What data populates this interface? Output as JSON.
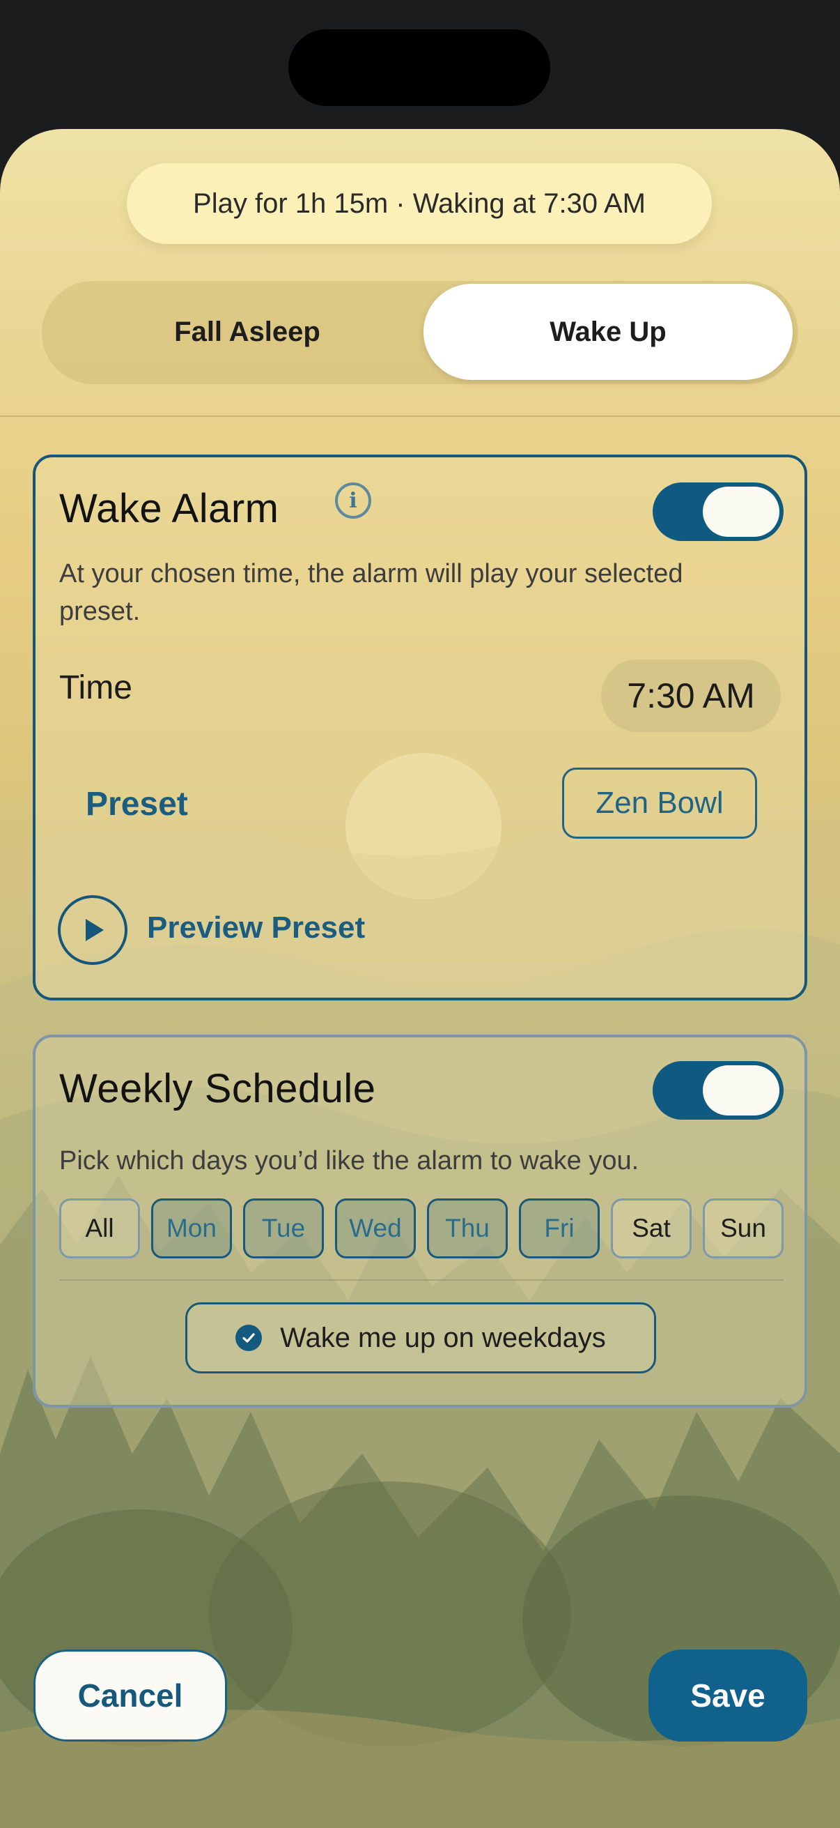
{
  "status_pill": {
    "text": "Play for 1h 15m  ·  Waking at 7:30 AM"
  },
  "mode_tabs": [
    {
      "label": "Fall Asleep",
      "selected": false
    },
    {
      "label": "Wake Up",
      "selected": true
    }
  ],
  "wake_alarm": {
    "title": "Wake Alarm",
    "info_icon": "info-icon",
    "enabled": true,
    "description": "At your chosen time, the alarm will play your selected preset.",
    "time_label": "Time",
    "time_value": "7:30 AM",
    "preset_label": "Preset",
    "preset_value": "Zen Bowl",
    "preview_label": "Preview Preset",
    "play_icon": "play-icon"
  },
  "weekly_schedule": {
    "title": "Weekly Schedule",
    "enabled": true,
    "description": "Pick which days you’d like the alarm to wake you.",
    "days": [
      {
        "label": "All",
        "selected": false
      },
      {
        "label": "Mon",
        "selected": true
      },
      {
        "label": "Tue",
        "selected": true
      },
      {
        "label": "Wed",
        "selected": true
      },
      {
        "label": "Thu",
        "selected": true
      },
      {
        "label": "Fri",
        "selected": true
      },
      {
        "label": "Sat",
        "selected": false
      },
      {
        "label": "Sun",
        "selected": false
      }
    ],
    "weekdays_option": {
      "label": "Wake me up on weekdays",
      "checked": true
    }
  },
  "actions": {
    "cancel": "Cancel",
    "save": "Save"
  },
  "colors": {
    "accent": "#10628d",
    "selected_day_text": "#2b6c8c",
    "pill_bg": "#fbf0b8"
  }
}
